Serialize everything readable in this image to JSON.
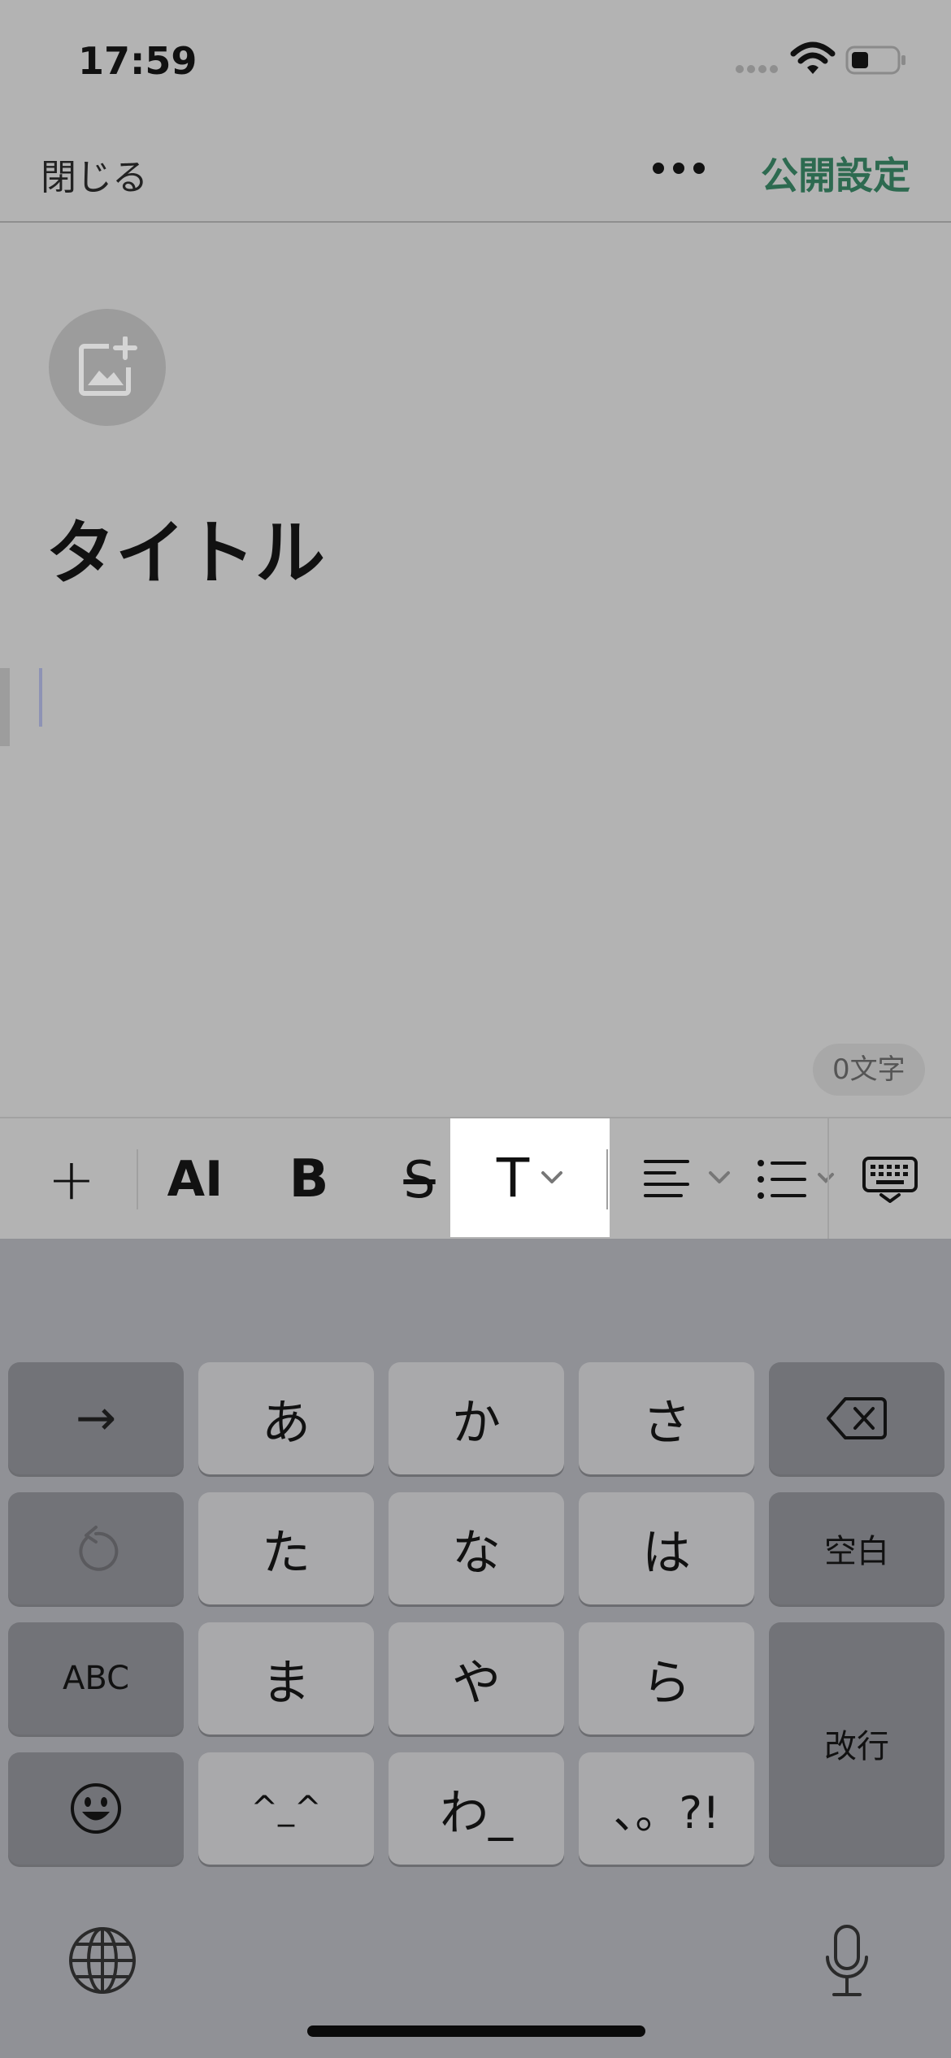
{
  "status_bar": {
    "time": "17:59"
  },
  "nav_bar": {
    "close_label": "閉じる",
    "publish_label": "公開設定"
  },
  "editor": {
    "title": "タイトル",
    "char_count": "0文字"
  },
  "toolbar": {
    "plus_label": "+",
    "ai_label": "AI",
    "bold_label": "B",
    "strike_label": "S",
    "text_style_label": "T"
  },
  "keyboard": {
    "keys": {
      "arrow": "→",
      "a": "あ",
      "ka": "か",
      "sa": "さ",
      "ta": "た",
      "na": "な",
      "ha": "は",
      "space": "空白",
      "abc": "ABC",
      "ma": "ま",
      "ya": "や",
      "ra": "ら",
      "enter": "改行",
      "kaomoji": "^_^",
      "wa": "わ_",
      "punct": "、。?!"
    }
  }
}
